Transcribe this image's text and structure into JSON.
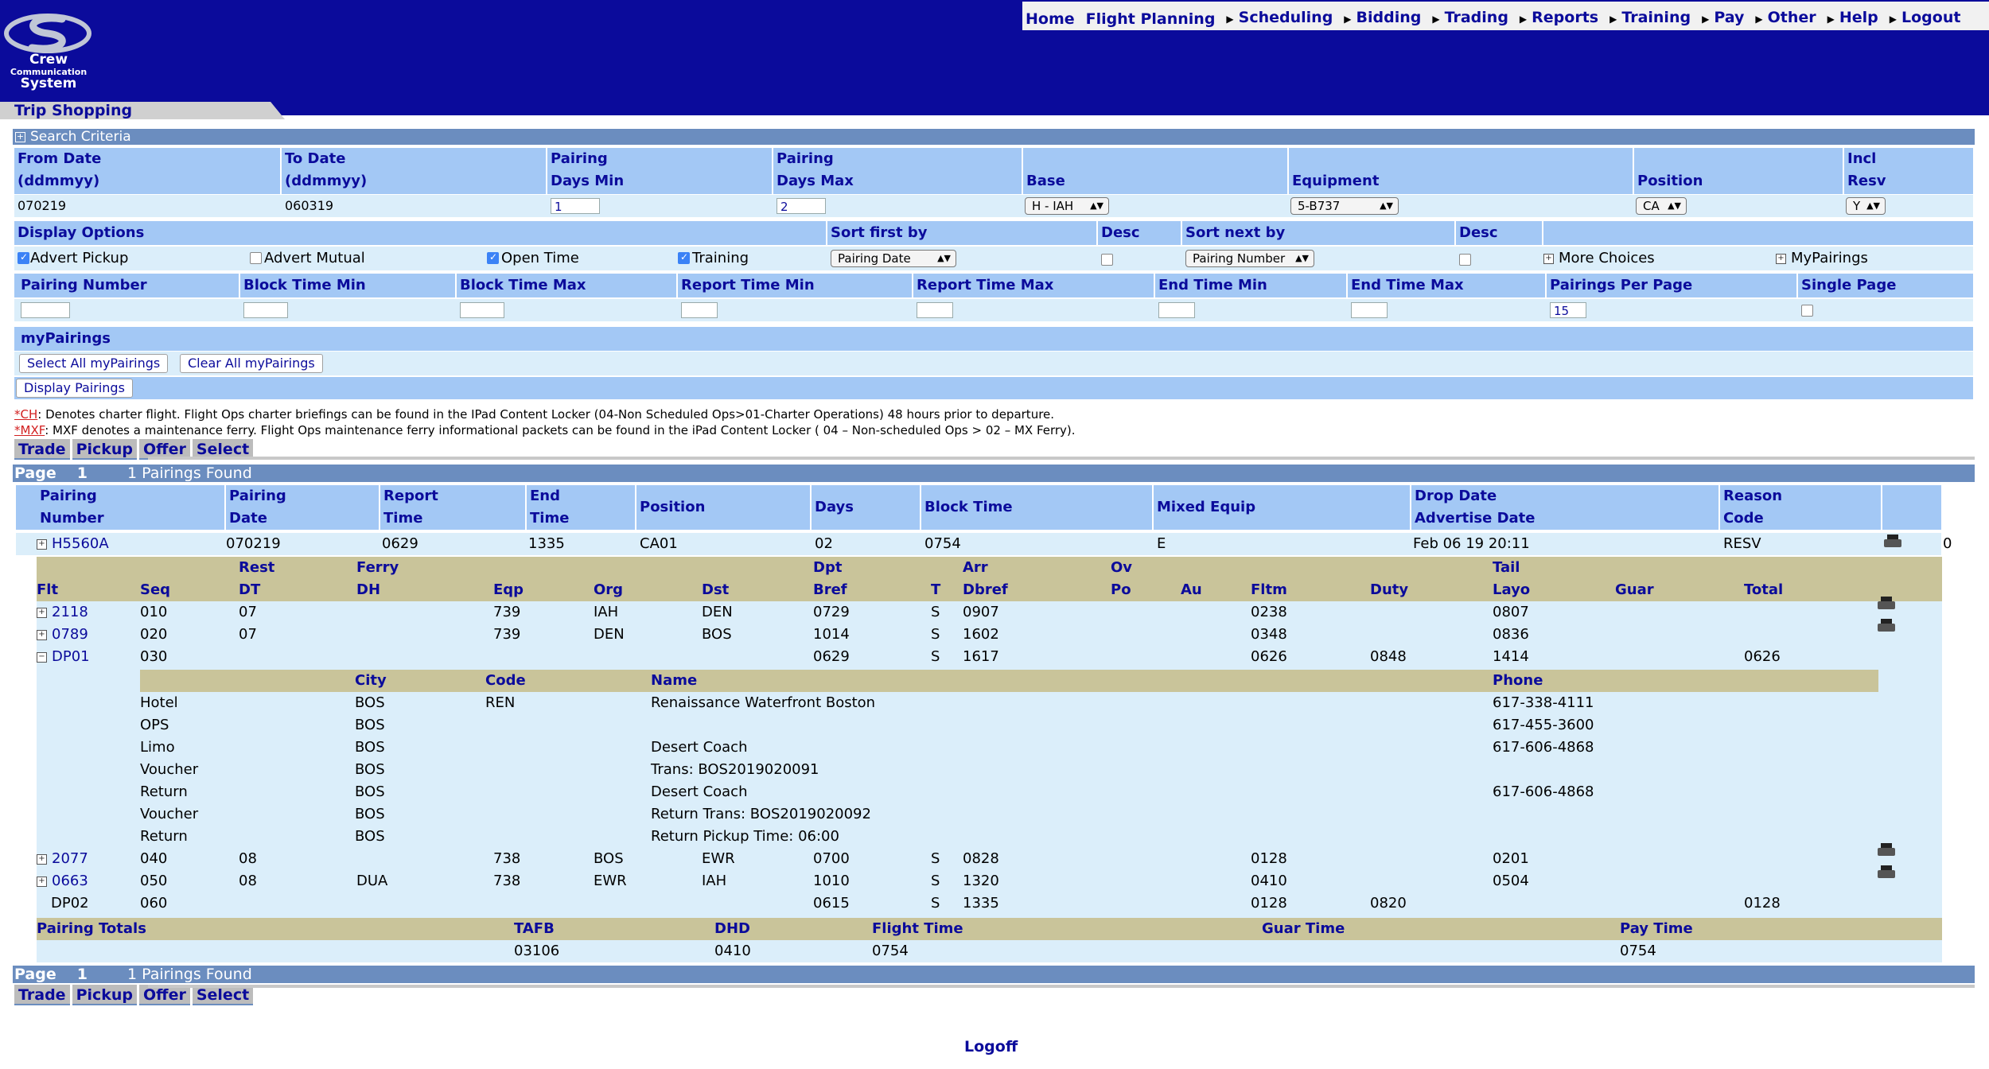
{
  "app": {
    "logo_line1": "Crew",
    "logo_line2": "Communication",
    "logo_line3": "System",
    "page_title": "Trip Shopping"
  },
  "nav": [
    {
      "label": "Home",
      "arrow": false
    },
    {
      "label": "Flight Planning",
      "arrow": false
    },
    {
      "label": "Scheduling",
      "arrow": true
    },
    {
      "label": "Bidding",
      "arrow": true
    },
    {
      "label": "Trading",
      "arrow": true
    },
    {
      "label": "Reports",
      "arrow": true
    },
    {
      "label": "Training",
      "arrow": true
    },
    {
      "label": "Pay",
      "arrow": true
    },
    {
      "label": "Other",
      "arrow": true
    },
    {
      "label": "Help",
      "arrow": true
    },
    {
      "label": "Logout",
      "arrow": true
    }
  ],
  "search": {
    "section_label": "Search Criteria",
    "labels": {
      "from_date_1": "From Date",
      "from_date_2": "(ddmmyy)",
      "to_date_1": "To Date",
      "to_date_2": "(ddmmyy)",
      "pdmin_1": "Pairing",
      "pdmin_2": "Days Min",
      "pdmax_1": "Pairing",
      "pdmax_2": "Days Max",
      "base": "Base",
      "equipment": "Equipment",
      "position": "Position",
      "resv_1": "Incl",
      "resv_2": "Resv"
    },
    "values": {
      "from_date": "070219",
      "to_date": "060319",
      "pdmin": "1",
      "pdmax": "2",
      "base": "H - IAH",
      "equipment": "5-B737",
      "position": "CA",
      "resv": "Y"
    },
    "display_options": "Display Options",
    "sort_first_by": "Sort first by",
    "desc": "Desc",
    "sort_next_by": "Sort next by",
    "opt_advert_pickup": "Advert Pickup",
    "opt_advert_mutual": "Advert Mutual",
    "opt_open_time": "Open Time",
    "opt_training": "Training",
    "sort_first_value": "Pairing Date",
    "sort_next_value": "Pairing Number",
    "more_choices": "More Choices",
    "mypairings_toggle": "MyPairings",
    "filters": {
      "pairing_number": "Pairing Number",
      "block_min": "Block Time Min",
      "block_max": "Block Time Max",
      "report_min": "Report Time Min",
      "report_max": "Report Time Max",
      "end_min": "End Time Min",
      "end_max": "End Time Max",
      "per_page": "Pairings Per Page",
      "single_page": "Single Page",
      "per_page_value": "15"
    },
    "mypairings_label": "myPairings",
    "select_all": "Select All myPairings",
    "clear_all": "Clear All myPairings",
    "display_pairings": "Display Pairings"
  },
  "notes": {
    "ch_tag": "CH",
    "ch_text": ": Denotes charter flight. Flight Ops charter briefings can be found in the IPad Content Locker (04-Non Scheduled Ops>01-Charter Operations) 48 hours prior to departure.",
    "mxf_tag": "MXF",
    "mxf_text": ": MXF denotes a maintenance ferry. Flight Ops maintenance ferry informational packets can be found in the iPad Content Locker ( 04 – Non-scheduled Ops > 02 – MX Ferry).",
    "star": "*"
  },
  "actions": [
    "Trade",
    "Pickup",
    "Offer",
    "Select"
  ],
  "page": {
    "label": "Page",
    "number": "1",
    "found": "1 Pairings Found"
  },
  "results_header": {
    "pairing_1": "Pairing",
    "pairing_2": "Number",
    "pdate_1": "Pairing",
    "pdate_2": "Date",
    "report_1": "Report",
    "report_2": "Time",
    "end_1": "End",
    "end_2": "Time",
    "position": "Position",
    "days": "Days",
    "block": "Block Time",
    "mixed": "Mixed Equip",
    "drop_1": "Drop Date",
    "drop_2": "Advertise Date",
    "reason_1": "Reason",
    "reason_2": "Code"
  },
  "pairing": {
    "number": "H5560A",
    "date": "070219",
    "report": "0629",
    "end": "1335",
    "position": "CA01",
    "days": "02",
    "block": "0754",
    "mixed": "E",
    "drop": "Feb 06 19 20:11",
    "reason": "RESV",
    "count": "0"
  },
  "detail_header": {
    "rest_1": "Rest",
    "ferry_1": "Ferry",
    "dpt_1": "Dpt",
    "arr_1": "Arr",
    "ov_1": "Ov",
    "tail_1": "Tail",
    "flt": "Flt",
    "seq": "Seq",
    "dt": "DT",
    "dh": "DH",
    "eqp": "Eqp",
    "org": "Org",
    "dst": "Dst",
    "bref": "Bref",
    "t": "T",
    "dbref": "Dbref",
    "po": "Po",
    "au": "Au",
    "fltm": "Fltm",
    "duty": "Duty",
    "layo": "Layo",
    "guar": "Guar",
    "total": "Total"
  },
  "legs": [
    {
      "flt": "2118",
      "seq": "010",
      "dt": "07",
      "dh": "",
      "eqp": "739",
      "org": "IAH",
      "dst": "DEN",
      "bref": "0729",
      "t": "S",
      "dbref": "0907",
      "fltm": "0238",
      "duty": "",
      "layo": "0807",
      "total": ""
    },
    {
      "flt": "0789",
      "seq": "020",
      "dt": "07",
      "dh": "",
      "eqp": "739",
      "org": "DEN",
      "dst": "BOS",
      "bref": "1014",
      "t": "S",
      "dbref": "1602",
      "fltm": "0348",
      "duty": "",
      "layo": "0836",
      "total": ""
    },
    {
      "flt": "DP01",
      "seq": "030",
      "dt": "",
      "dh": "",
      "eqp": "",
      "org": "",
      "dst": "",
      "bref": "0629",
      "t": "S",
      "dbref": "1617",
      "fltm": "0626",
      "duty": "0848",
      "layo": "1414",
      "total": "0626"
    },
    {
      "flt": "2077",
      "seq": "040",
      "dt": "08",
      "dh": "",
      "eqp": "738",
      "org": "BOS",
      "dst": "EWR",
      "bref": "0700",
      "t": "S",
      "dbref": "0828",
      "fltm": "0128",
      "duty": "",
      "layo": "0201",
      "total": ""
    },
    {
      "flt": "0663",
      "seq": "050",
      "dt": "08",
      "dh": "DUA",
      "eqp": "738",
      "org": "EWR",
      "dst": "IAH",
      "bref": "1010",
      "t": "S",
      "dbref": "1320",
      "fltm": "0410",
      "duty": "",
      "layo": "0504",
      "total": ""
    },
    {
      "flt": "DP02",
      "seq": "060",
      "dt": "",
      "dh": "",
      "eqp": "",
      "org": "",
      "dst": "",
      "bref": "0615",
      "t": "S",
      "dbref": "1335",
      "fltm": "0128",
      "duty": "0820",
      "layo": "",
      "total": "0128"
    }
  ],
  "hotel_header": {
    "city": "City",
    "code": "Code",
    "name": "Name",
    "phone": "Phone"
  },
  "hotel_rows": [
    {
      "type": "Hotel",
      "city": "BOS",
      "code": "REN",
      "name": "Renaissance Waterfront Boston",
      "phone": "617-338-4111"
    },
    {
      "type": "OPS",
      "city": "BOS",
      "code": "",
      "name": "",
      "phone": "617-455-3600"
    },
    {
      "type": "Limo",
      "city": "BOS",
      "code": "",
      "name": "Desert Coach",
      "phone": "617-606-4868"
    },
    {
      "type": "Voucher",
      "city": "BOS",
      "code": "",
      "name": "Trans: BOS2019020091",
      "phone": ""
    },
    {
      "type": "Return",
      "city": "BOS",
      "code": "",
      "name": "Desert Coach",
      "phone": "617-606-4868"
    },
    {
      "type": "Voucher",
      "city": "BOS",
      "code": "",
      "name": "Return Trans: BOS2019020092",
      "phone": ""
    },
    {
      "type": "Return",
      "city": "BOS",
      "code": "",
      "name": "Return Pickup Time: 06:00",
      "phone": ""
    }
  ],
  "totals": {
    "label": "Pairing Totals",
    "tafb_label": "TAFB",
    "dhd_label": "DHD",
    "flight_label": "Flight Time",
    "guar_label": "Guar Time",
    "pay_label": "Pay Time",
    "tafb": "03106",
    "dhd": "0410",
    "flight": "0754",
    "pay": "0754"
  },
  "footer": {
    "logoff": "Logoff"
  }
}
